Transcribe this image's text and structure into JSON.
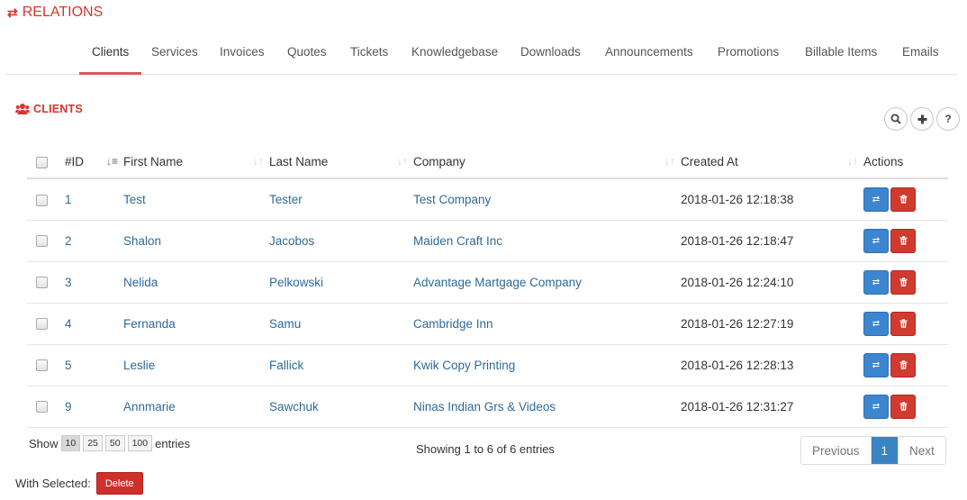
{
  "header": {
    "title": "RELATIONS",
    "icon": "exchange-icon",
    "accent": "#d9342b"
  },
  "tabs": [
    {
      "label": "Clients",
      "active": true
    },
    {
      "label": "Services"
    },
    {
      "label": "Invoices"
    },
    {
      "label": "Quotes"
    },
    {
      "label": "Tickets"
    },
    {
      "label": "Knowledgebase"
    },
    {
      "label": "Downloads"
    },
    {
      "label": "Announcements"
    },
    {
      "label": "Promotions"
    },
    {
      "label": "Billable Items"
    },
    {
      "label": "Emails"
    }
  ],
  "section": {
    "title": "CLIENTS",
    "icon": "users-icon"
  },
  "toolbar": {
    "search_icon": "search-icon",
    "add_icon": "plus-icon",
    "help_icon": "question-icon"
  },
  "table": {
    "columns": [
      "#ID",
      "First Name",
      "Last Name",
      "Company",
      "Created At",
      "Actions"
    ],
    "rows": [
      {
        "id": "1",
        "first": "Test",
        "last": "Tester",
        "company": "Test Company",
        "created": "2018-01-26 12:18:38"
      },
      {
        "id": "2",
        "first": "Shalon",
        "last": "Jacobos",
        "company": "Maiden Craft Inc",
        "created": "2018-01-26 12:18:47"
      },
      {
        "id": "3",
        "first": "Nelida",
        "last": "Pelkowski",
        "company": "Advantage Martgage Company",
        "created": "2018-01-26 12:24:10"
      },
      {
        "id": "4",
        "first": "Fernanda",
        "last": "Samu",
        "company": "Cambridge Inn",
        "created": "2018-01-26 12:27:19"
      },
      {
        "id": "5",
        "first": "Leslie",
        "last": "Fallick",
        "company": "Kwik Copy Printing",
        "created": "2018-01-26 12:28:13"
      },
      {
        "id": "9",
        "first": "Annmarie",
        "last": "Sawchuk",
        "company": "Ninas Indian Grs & Videos",
        "created": "2018-01-26 12:31:27"
      }
    ]
  },
  "length_menu": {
    "label_before": "Show",
    "options": [
      "10",
      "25",
      "50",
      "100"
    ],
    "selected": "10",
    "label_after": "entries"
  },
  "info": "Showing 1 to 6 of 6 entries",
  "pagination": {
    "previous": "Previous",
    "current": "1",
    "next": "Next"
  },
  "bulk": {
    "label": "With Selected:",
    "delete": "Delete"
  },
  "colors": {
    "link": "#2f6a99",
    "primary": "#3c86cf",
    "danger": "#d03a2f"
  }
}
